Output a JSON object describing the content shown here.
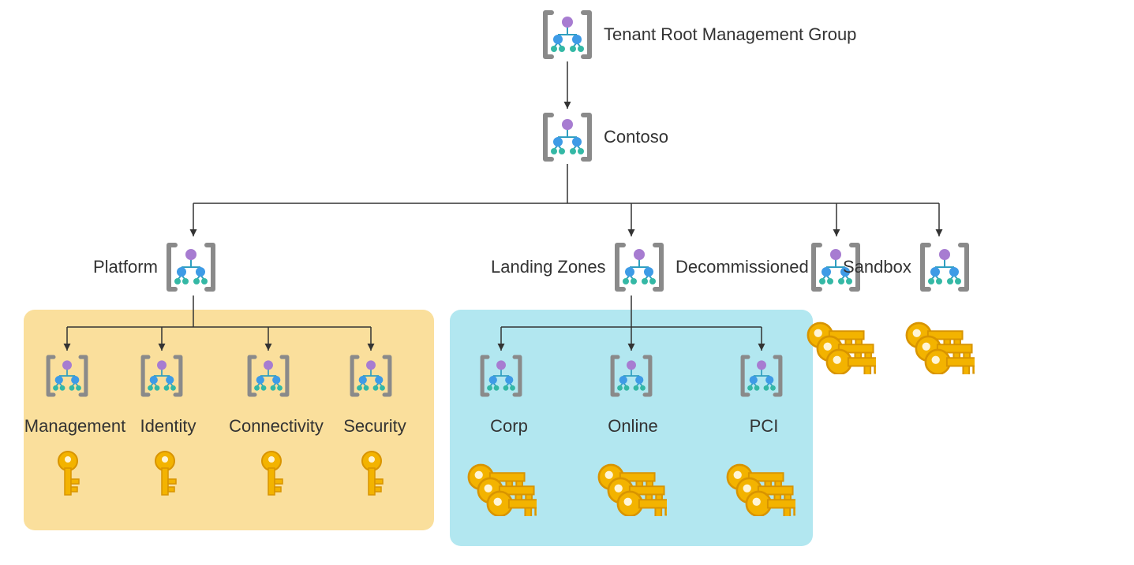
{
  "root": {
    "label": "Tenant Root Management Group"
  },
  "tenant": {
    "label": "Contoso"
  },
  "level3": {
    "platform": {
      "label": "Platform"
    },
    "landing_zones": {
      "label": "Landing Zones"
    },
    "decommissioned": {
      "label": "Decommissioned"
    },
    "sandbox": {
      "label": "Sandbox"
    }
  },
  "platform_children": {
    "management": {
      "label": "Management"
    },
    "identity": {
      "label": "Identity"
    },
    "connectivity": {
      "label": "Connectivity"
    },
    "security": {
      "label": "Security"
    }
  },
  "lz_children": {
    "corp": {
      "label": "Corp"
    },
    "online": {
      "label": "Online"
    },
    "pci": {
      "label": "PCI"
    }
  }
}
